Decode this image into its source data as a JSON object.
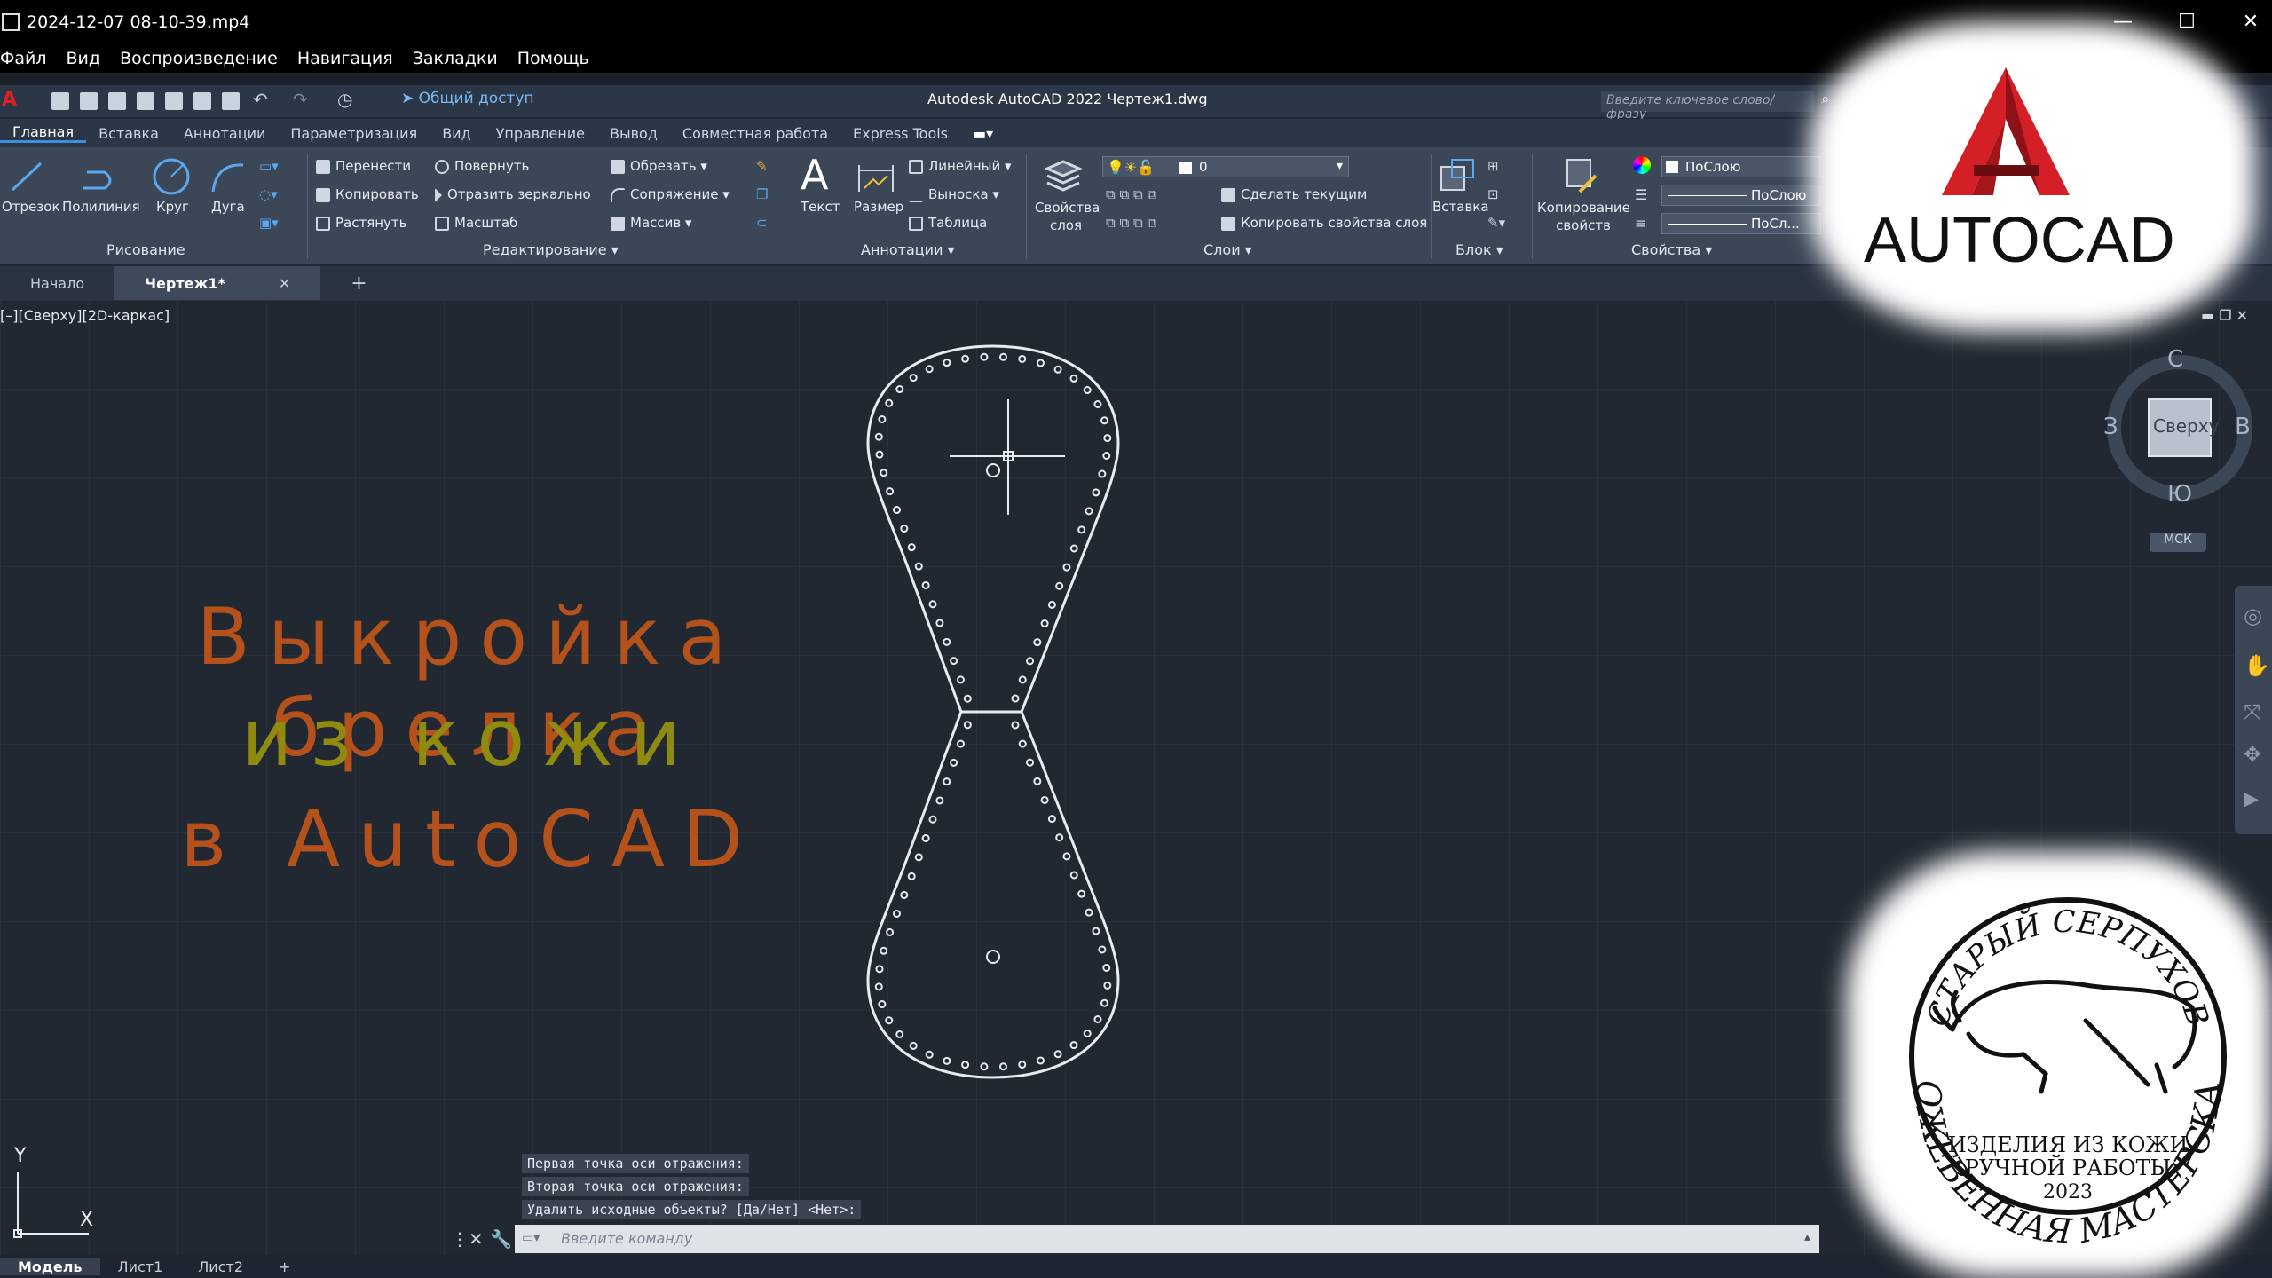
{
  "player": {
    "filename": "2024-12-07 08-10-39.mp4",
    "menu": [
      "Файл",
      "Вид",
      "Воспроизведение",
      "Навигация",
      "Закладки",
      "Помощь"
    ]
  },
  "acad": {
    "app_title": "Autodesk AutoCAD 2022   Чертеж1.dwg",
    "share_label": "Общий доступ",
    "search_placeholder": "Введите ключевое слово/фразу",
    "ribbon_tabs": [
      "Главная",
      "Вставка",
      "Аннотации",
      "Параметризация",
      "Вид",
      "Управление",
      "Вывод",
      "Совместная работа",
      "Express Tools"
    ],
    "draw": {
      "line": "Отрезок",
      "polyline": "Полилиния",
      "circle": "Круг",
      "arc": "Дуга",
      "title": "Рисование"
    },
    "modify": {
      "move": "Перенести",
      "rotate": "Повернуть",
      "trim": "Обрезать",
      "copy": "Копировать",
      "mirror": "Отразить зеркально",
      "fillet": "Сопряжение",
      "stretch": "Растянуть",
      "scale": "Масштаб",
      "array": "Массив",
      "title": "Редактирование"
    },
    "annotation": {
      "text": "Текст",
      "dimension": "Размер",
      "linear": "Линейный",
      "leader": "Выноска",
      "table": "Таблица",
      "title": "Аннотации"
    },
    "layers": {
      "props": "Свойства слоя",
      "layer_value": "0",
      "make_current": "Сделать текущим",
      "match_layer": "Копировать свойства слоя",
      "title": "Слои"
    },
    "block": {
      "insert": "Вставка",
      "title": "Блок"
    },
    "properties": {
      "match": "Копирование свойств",
      "color": "ПоСлою",
      "linetype": "ПоСлою",
      "lineweight": "ПоСл...",
      "title": "Свойства"
    },
    "doc_tabs": [
      "Начало",
      "Чертеж1*"
    ],
    "viewport_label": "[–][Сверху][2D-каркас]",
    "viewcube": {
      "north": "С",
      "south": "Ю",
      "west": "З",
      "east": "В",
      "face": "Сверху",
      "ucs": "МСК"
    },
    "command_history": [
      "Первая точка оси отражения:",
      "Вторая точка оси отражения:",
      "Удалить исходные объекты? [Да/Нет] <Нет>:"
    ],
    "command_placeholder": "Введите команду",
    "layout_tabs": [
      "Модель",
      "Лист1",
      "Лист2"
    ],
    "ucs_x": "X",
    "ucs_y": "Y"
  },
  "overlay": {
    "line1": "Выкройка брелка",
    "line2": "из кожи",
    "line3": "в AutoCAD",
    "color1": "#b5521c",
    "color2": "#8f8a10",
    "color3": "#b5521c",
    "autocad_logo_text": "AUTOCAD",
    "stamp": {
      "top": "СТАРЫЙ СЕРПУХОВ",
      "mid1": "ИЗДЕЛИЯ ИЗ КОЖИ",
      "mid2": "РУЧНОЙ РАБОТЫ",
      "year": "2023",
      "bottom": "КОЖЕВЕННАЯ МАСТЕРСКАЯ"
    }
  }
}
